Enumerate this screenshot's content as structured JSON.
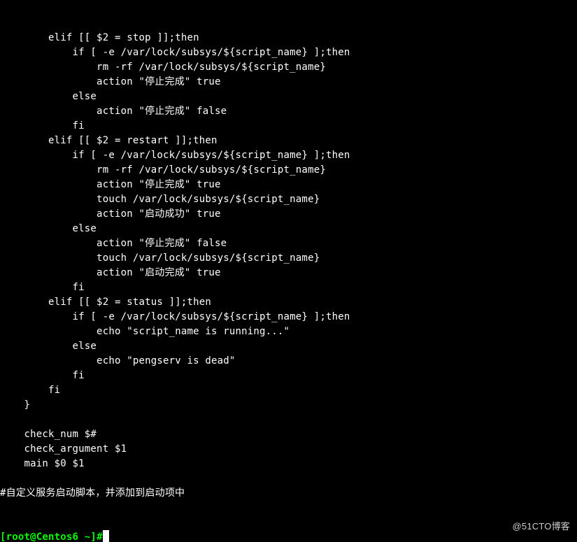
{
  "code": {
    "lines": [
      "        elif [[ $2 = stop ]];then",
      "            if [ -e /var/lock/subsys/${script_name} ];then",
      "                rm -rf /var/lock/subsys/${script_name}",
      "                action \"停止完成\" true",
      "            else",
      "                action \"停止完成\" false",
      "            fi",
      "        elif [[ $2 = restart ]];then",
      "            if [ -e /var/lock/subsys/${script_name} ];then",
      "                rm -rf /var/lock/subsys/${script_name}",
      "                action \"停止完成\" true",
      "                touch /var/lock/subsys/${script_name}",
      "                action \"启动成功\" true",
      "            else",
      "                action \"停止完成\" false",
      "                touch /var/lock/subsys/${script_name}",
      "                action \"启动完成\" true",
      "            fi",
      "        elif [[ $2 = status ]];then",
      "            if [ -e /var/lock/subsys/${script_name} ];then",
      "                echo \"script_name is running...\"",
      "            else",
      "                echo \"pengserv is dead\"",
      "            fi",
      "        fi",
      "    }",
      "",
      "    check_num $#",
      "    check_argument $1",
      "    main $0 $1",
      "",
      "#自定义服务启动脚本，并添加到启动项中"
    ]
  },
  "prompt": {
    "user_host": "[root@Centos6 ~]",
    "hash": "#"
  },
  "watermark": "@51CTO博客"
}
